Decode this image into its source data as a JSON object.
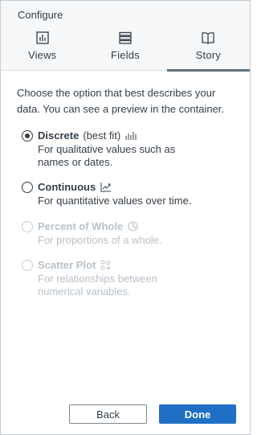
{
  "header": {
    "title": "Configure",
    "tabs": [
      {
        "label": "Views",
        "icon": "bar-chart-icon",
        "active": false
      },
      {
        "label": "Fields",
        "icon": "list-icon",
        "active": false
      },
      {
        "label": "Story",
        "icon": "book-icon",
        "active": true
      }
    ]
  },
  "intro": "Choose the option that best describes your data. You can see a preview in the container.",
  "options": [
    {
      "title": "Discrete",
      "fit": "(best fit)",
      "desc": "For qualitative values such as names or dates.",
      "icon": "discrete-bars-icon",
      "checked": true,
      "disabled": false
    },
    {
      "title": "Continuous",
      "desc": "For quantitative values over time.",
      "icon": "line-trend-icon",
      "checked": false,
      "disabled": false
    },
    {
      "title": "Percent of Whole",
      "desc": "For proportions of a whole.",
      "icon": "pie-icon",
      "checked": false,
      "disabled": true
    },
    {
      "title": "Scatter Plot",
      "desc": "For relationships between numerical variables.",
      "icon": "scatter-icon",
      "checked": false,
      "disabled": true
    }
  ],
  "buttons": {
    "back": "Back",
    "done": "Done"
  },
  "colors": {
    "primary": "#1f6fc5",
    "text": "#333e48",
    "disabled": "#b8c1ca",
    "header_bg": "#f5f7f9"
  }
}
